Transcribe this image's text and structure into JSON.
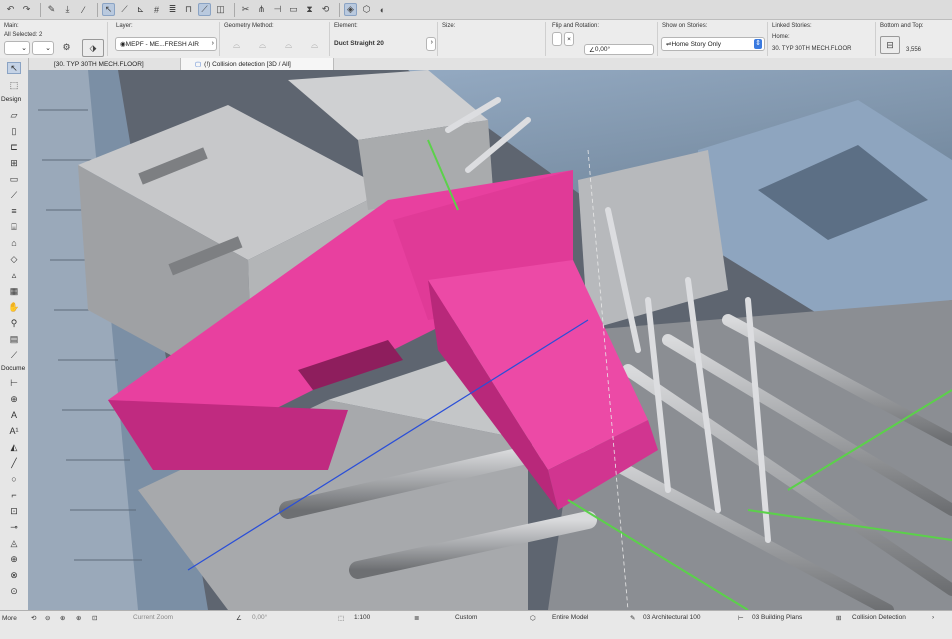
{
  "toolbar": {
    "icons": [
      "undo-icon",
      "redo-icon",
      "pick-up-icon",
      "inject-icon",
      "eyedropper-icon",
      "arrow-tool-icon",
      "guide-line-icon",
      "snap-icon",
      "grid-icon",
      "layers-icon",
      "lock-icon",
      "magic-wand-icon",
      "suspend-groups-icon",
      "trim-icon",
      "split-icon",
      "adjust-icon",
      "offset-icon",
      "mirror-icon",
      "rotate-icon",
      "rendering-icon",
      "view-3d-icon",
      "surfaces-icon"
    ]
  },
  "infobox": {
    "main_label": "Main:",
    "selection_count": "All Selected: 2",
    "layer_label": "Layer:",
    "layer_value": "MEPF - ME...FRESH AIR",
    "geometry_label": "Geometry Method:",
    "element_label": "Element:",
    "element_value": "Duct Straight 20",
    "size_label": "Size:",
    "flip_label": "Flip and Rotation:",
    "rotation_value": "0,00°",
    "show_on_stories_label": "Show on Stories:",
    "show_on_stories_value": "Home Story Only",
    "linked_stories_label": "Linked Stories:",
    "home_label": "Home:",
    "home_value": "30. TYP 30TH MECH.FLOOR",
    "bottom_top_label": "Bottom and Top:",
    "bottom_top_value": "3,556"
  },
  "tabs": [
    {
      "label": "[30. TYP 30TH MECH.FLOOR]"
    },
    {
      "label": "(!) Collision detection [3D / All]"
    }
  ],
  "toolbox": {
    "design_label": "Design",
    "document_label": "Docume",
    "more_label": "More"
  },
  "status": {
    "current_zoom_label": "Current Zoom",
    "angle_value": "0,00°",
    "scale_value": "1:100",
    "layer_combo": "Custom",
    "model_view": "Entire Model",
    "pen_set": "03 Architectural 100",
    "dimension": "03 Building Plans",
    "renovation": "Collision Detection"
  },
  "colors": {
    "highlight": "#e8409f",
    "highlight_dark": "#c02a80",
    "duct_gray": "#a9abae",
    "slab_blue": "#8aa2bc",
    "background": "#565d68"
  }
}
